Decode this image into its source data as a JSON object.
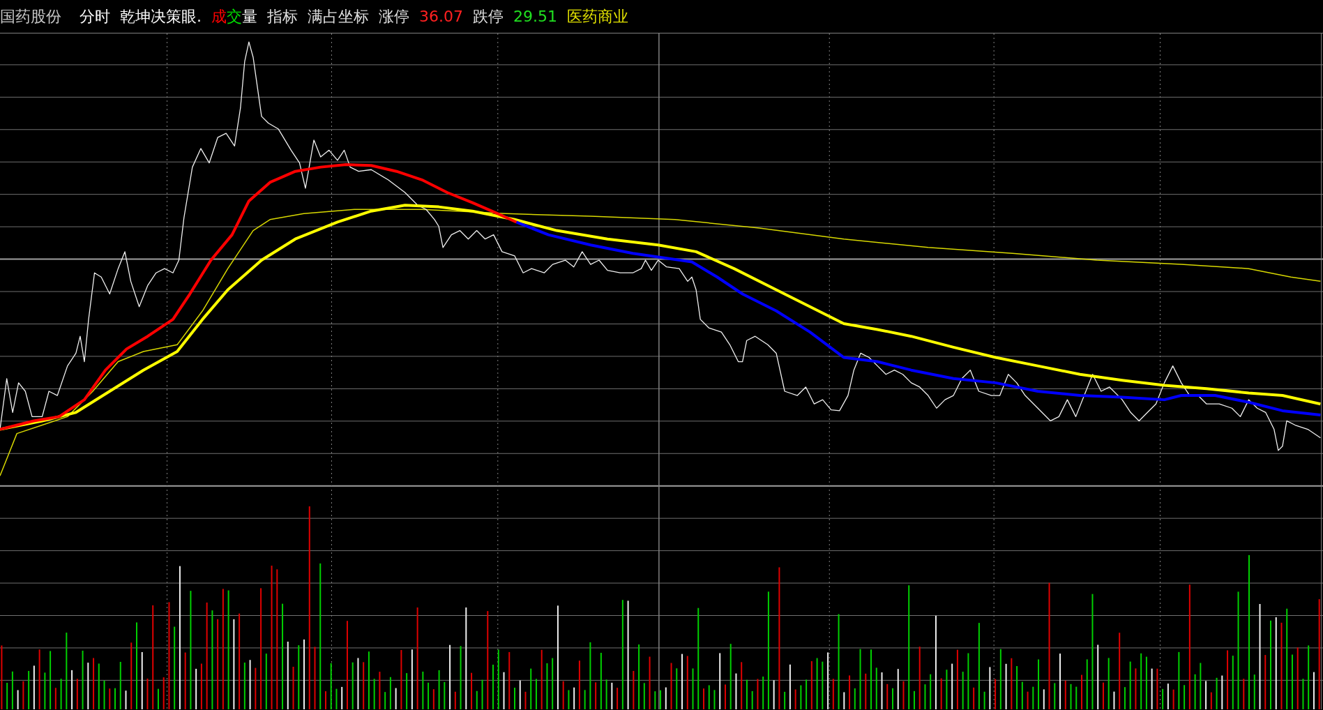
{
  "header": {
    "items": [
      {
        "kind": "plain",
        "text": "国药股份",
        "color": "#c8c8c8"
      },
      {
        "kind": "plain",
        "text": "分时",
        "color": "#ffffff"
      },
      {
        "kind": "plain",
        "text": "乾坤决策眼.",
        "color": "#ffffff"
      },
      {
        "kind": "multicolor",
        "segments": [
          {
            "text": "成",
            "color": "#ff0000"
          },
          {
            "text": "交",
            "color": "#00e000"
          },
          {
            "text": "量",
            "color": "#ffffff"
          }
        ]
      },
      {
        "kind": "plain",
        "text": "指标",
        "color": "#e0e0e0"
      },
      {
        "kind": "plain",
        "text": "满占坐标",
        "color": "#e0e0e0"
      },
      {
        "kind": "plain",
        "text": "涨停",
        "color": "#e0e0e0"
      },
      {
        "kind": "plain",
        "text": "36.07",
        "color": "#ff2020"
      },
      {
        "kind": "plain",
        "text": "跌停",
        "color": "#e0e0e0"
      },
      {
        "kind": "plain",
        "text": "29.51",
        "color": "#20e020"
      },
      {
        "kind": "plain",
        "text": "医药商业",
        "color": "#e0e000"
      }
    ]
  }
}
